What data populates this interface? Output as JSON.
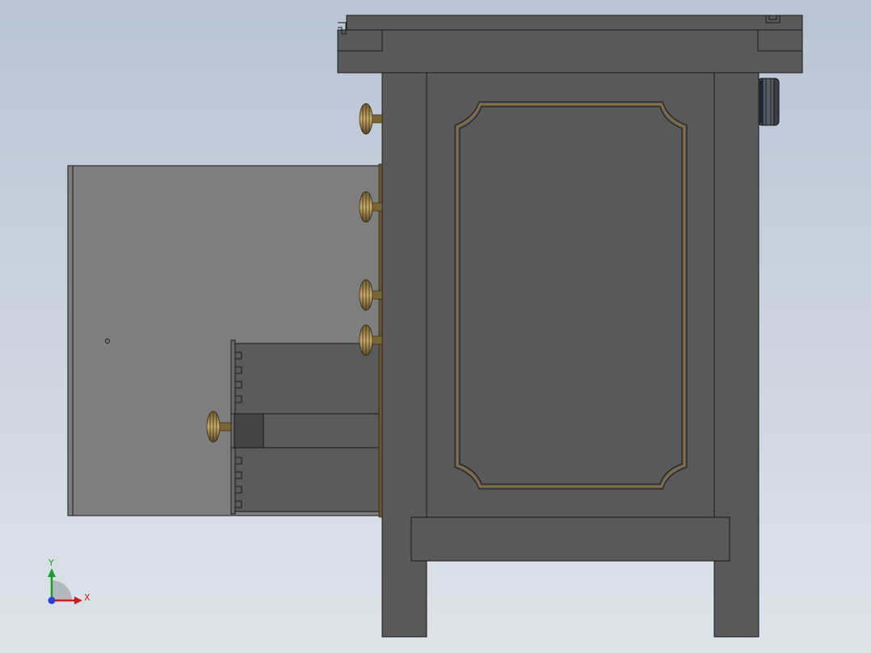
{
  "viewport": {
    "background_top": "#b9c4d4",
    "background_bottom": "#dfe3ea"
  },
  "model": {
    "colors": {
      "body": "#595959",
      "body_dark": "#4b4b4b",
      "outline": "#1a1a1a",
      "drawer_side": "#7e7e7e",
      "drawer_box": "#5a5a5a",
      "brass": "#8a7040",
      "brass_light": "#c6a867",
      "caster": "#3a3f48"
    }
  },
  "triad": {
    "y_label": "Y",
    "x_label": "X",
    "y_color": "#1a9e2c",
    "x_color": "#c42020",
    "z_color": "#2b3fd6"
  }
}
